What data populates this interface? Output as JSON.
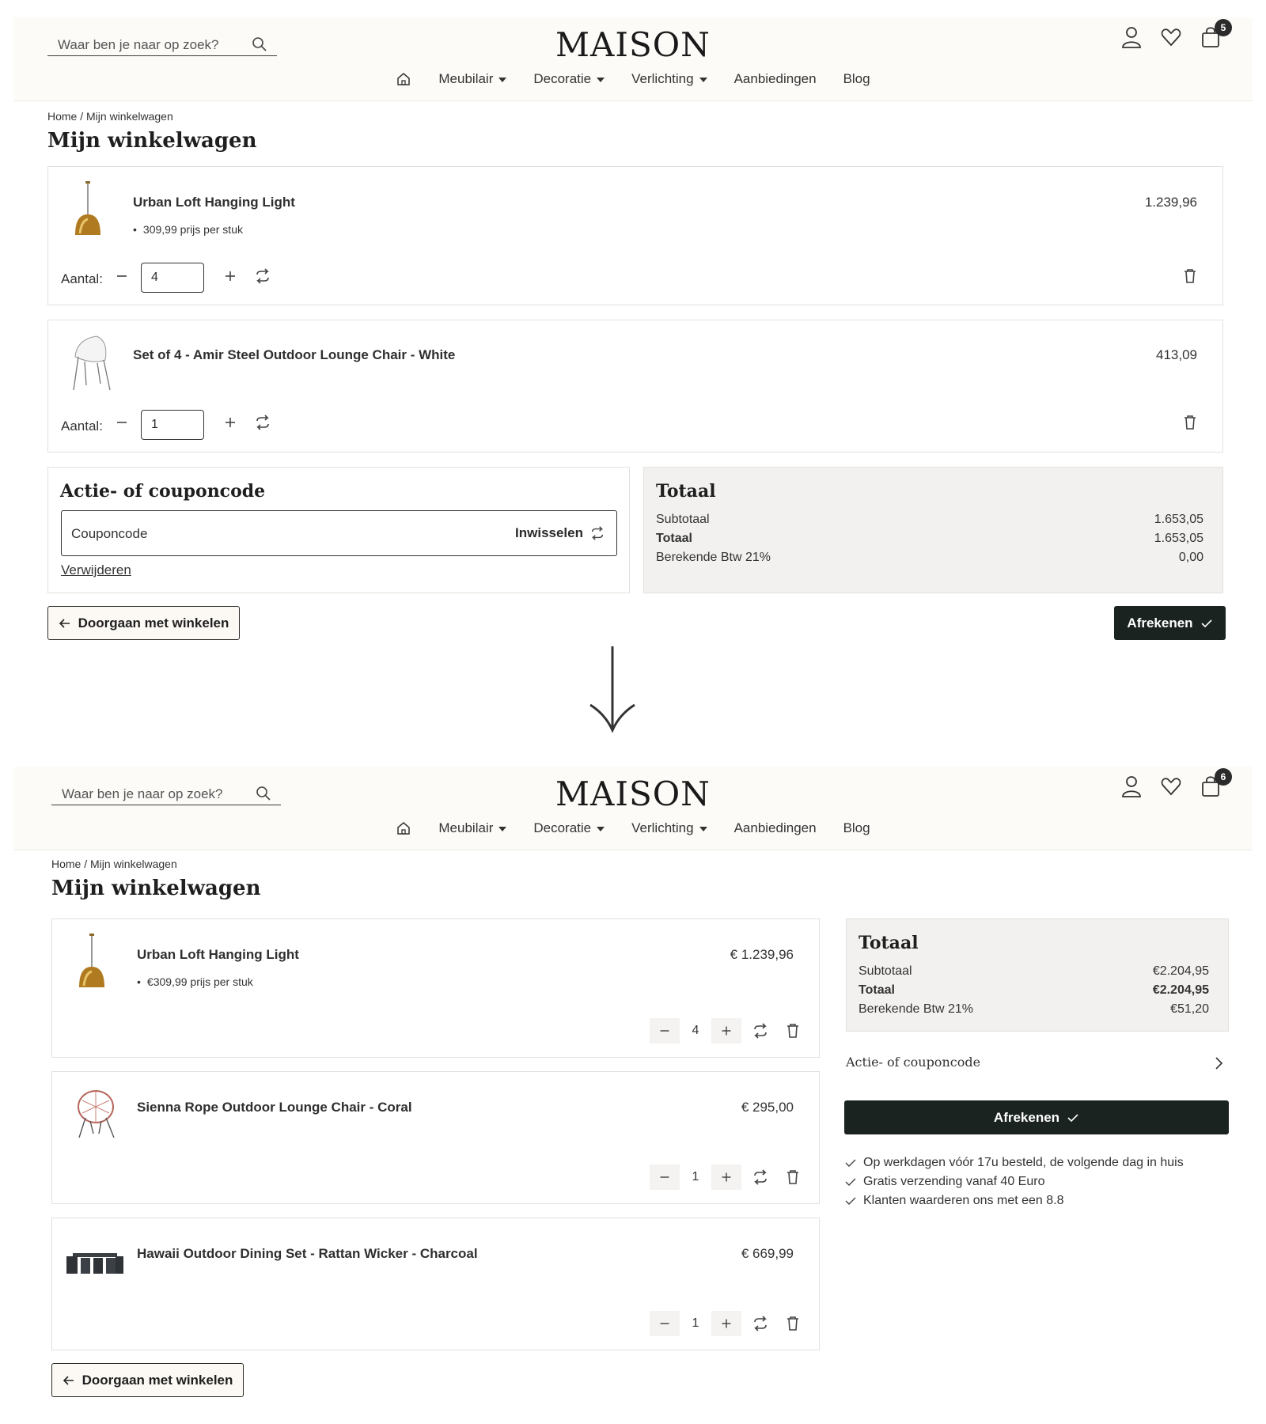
{
  "header": {
    "search_placeholder": "Waar ben je naar op zoek?",
    "logo": "MAISON",
    "nav": [
      "Meubilair",
      "Decoratie",
      "Verlichting",
      "Aanbiedingen",
      "Blog"
    ]
  },
  "breadcrumb": "Home / Mijn winkelwagen",
  "page_title": "Mijn winkelwagen",
  "before": {
    "cart_count": "5",
    "items": [
      {
        "name": "Urban Loft Hanging Light",
        "price": "1.239,96",
        "unit": "309,99 prijs per stuk",
        "qty": "4",
        "qty_label": "Aantal:"
      },
      {
        "name": "Set of 4 - Amir Steel Outdoor Lounge Chair - White",
        "price": "413,09",
        "qty": "1",
        "qty_label": "Aantal:"
      }
    ],
    "coupon": {
      "title": "Actie- of couponcode",
      "placeholder": "Couponcode",
      "redeem": "Inwisselen",
      "remove": "Verwijderen"
    },
    "summary": {
      "title": "Totaal",
      "rows": [
        {
          "label": "Subtotaal",
          "value": "1.653,05"
        },
        {
          "label": "Totaal",
          "value": "1.653,05"
        },
        {
          "label": "Berekende Btw 21%",
          "value": "0,00"
        }
      ]
    },
    "continue": "Doorgaan met winkelen",
    "checkout": "Afrekenen"
  },
  "after": {
    "cart_count": "6",
    "items": [
      {
        "name": "Urban Loft Hanging Light",
        "price": "€ 1.239,96",
        "unit": "€309,99 prijs per stuk",
        "qty": "4"
      },
      {
        "name": "Sienna Rope Outdoor Lounge Chair - Coral",
        "price": "€ 295,00",
        "qty": "1"
      },
      {
        "name": "Hawaii Outdoor Dining Set - Rattan Wicker - Charcoal",
        "price": "€ 669,99",
        "qty": "1"
      }
    ],
    "summary": {
      "title": "Totaal",
      "rows": [
        {
          "label": "Subtotaal",
          "value": "€2.204,95"
        },
        {
          "label": "Totaal",
          "value": "€2.204,95"
        },
        {
          "label": "Berekende Btw 21%",
          "value": "€51,20"
        }
      ]
    },
    "coupon_toggle": "Actie- of couponcode",
    "checkout": "Afrekenen",
    "usps": [
      "Op werkdagen vóór 17u besteld, de volgende dag in huis",
      "Gratis verzending vanaf 40 Euro",
      "Klanten waarderen ons met een 8.8"
    ],
    "continue": "Doorgaan met winkelen"
  }
}
